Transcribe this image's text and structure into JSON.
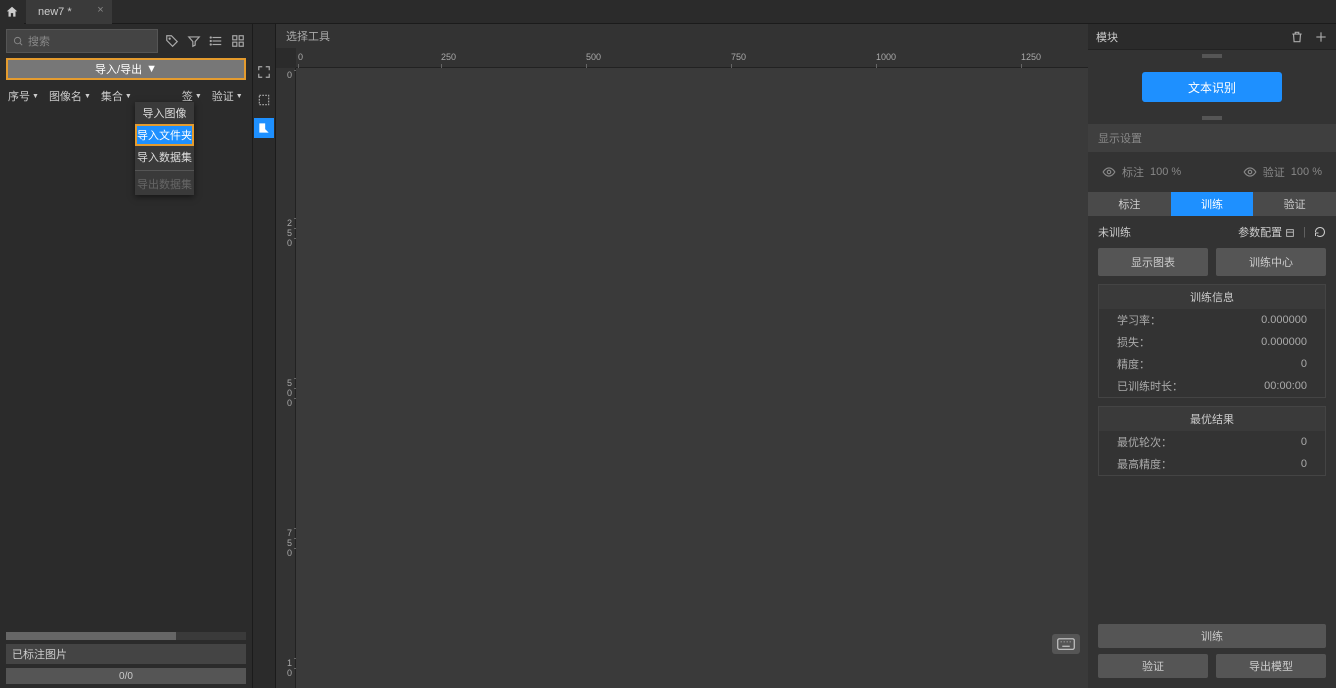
{
  "topbar": {
    "tab_title": "new7 *"
  },
  "left": {
    "search_placeholder": "搜索",
    "import_button": "导入/导出",
    "columns": [
      "序号",
      "图像名",
      "集合",
      "签",
      "验证"
    ],
    "dropdown": {
      "items": [
        "导入图像",
        "导入文件夹",
        "导入数据集",
        "导出数据集"
      ],
      "highlight_index": 1,
      "disabled_index": 3
    },
    "annotated_label": "已标注图片",
    "count": "0/0"
  },
  "canvas": {
    "tool_title": "选择工具",
    "ruler_h": [
      "0",
      "250",
      "500",
      "750",
      "1000",
      "1250"
    ],
    "ruler_v": [
      "0",
      "2",
      "5",
      "0",
      "5",
      "0",
      "0",
      "7",
      "5",
      "0",
      "1",
      "0"
    ]
  },
  "right": {
    "panel_title": "模块",
    "module_button": "文本识别",
    "display_settings": "显示设置",
    "vis": {
      "label1": "标注",
      "val1": "100 %",
      "label2": "验证",
      "val2": "100 %"
    },
    "tabs": [
      "标注",
      "训练",
      "验证"
    ],
    "active_tab": 1,
    "status": "未训练",
    "params_label": "参数配置",
    "btns": [
      "显示图表",
      "训练中心"
    ],
    "train_info_title": "训练信息",
    "train_info": [
      {
        "k": "学习率：",
        "v": "0.000000"
      },
      {
        "k": "损失：",
        "v": "0.000000"
      },
      {
        "k": "精度：",
        "v": "0"
      },
      {
        "k": "已训练时长：",
        "v": "00:00:00"
      }
    ],
    "best_title": "最优结果",
    "best": [
      {
        "k": "最优轮次：",
        "v": "0"
      },
      {
        "k": "最高精度：",
        "v": "0"
      }
    ],
    "bottom": {
      "train": "训练",
      "validate": "验证",
      "export": "导出模型"
    }
  }
}
